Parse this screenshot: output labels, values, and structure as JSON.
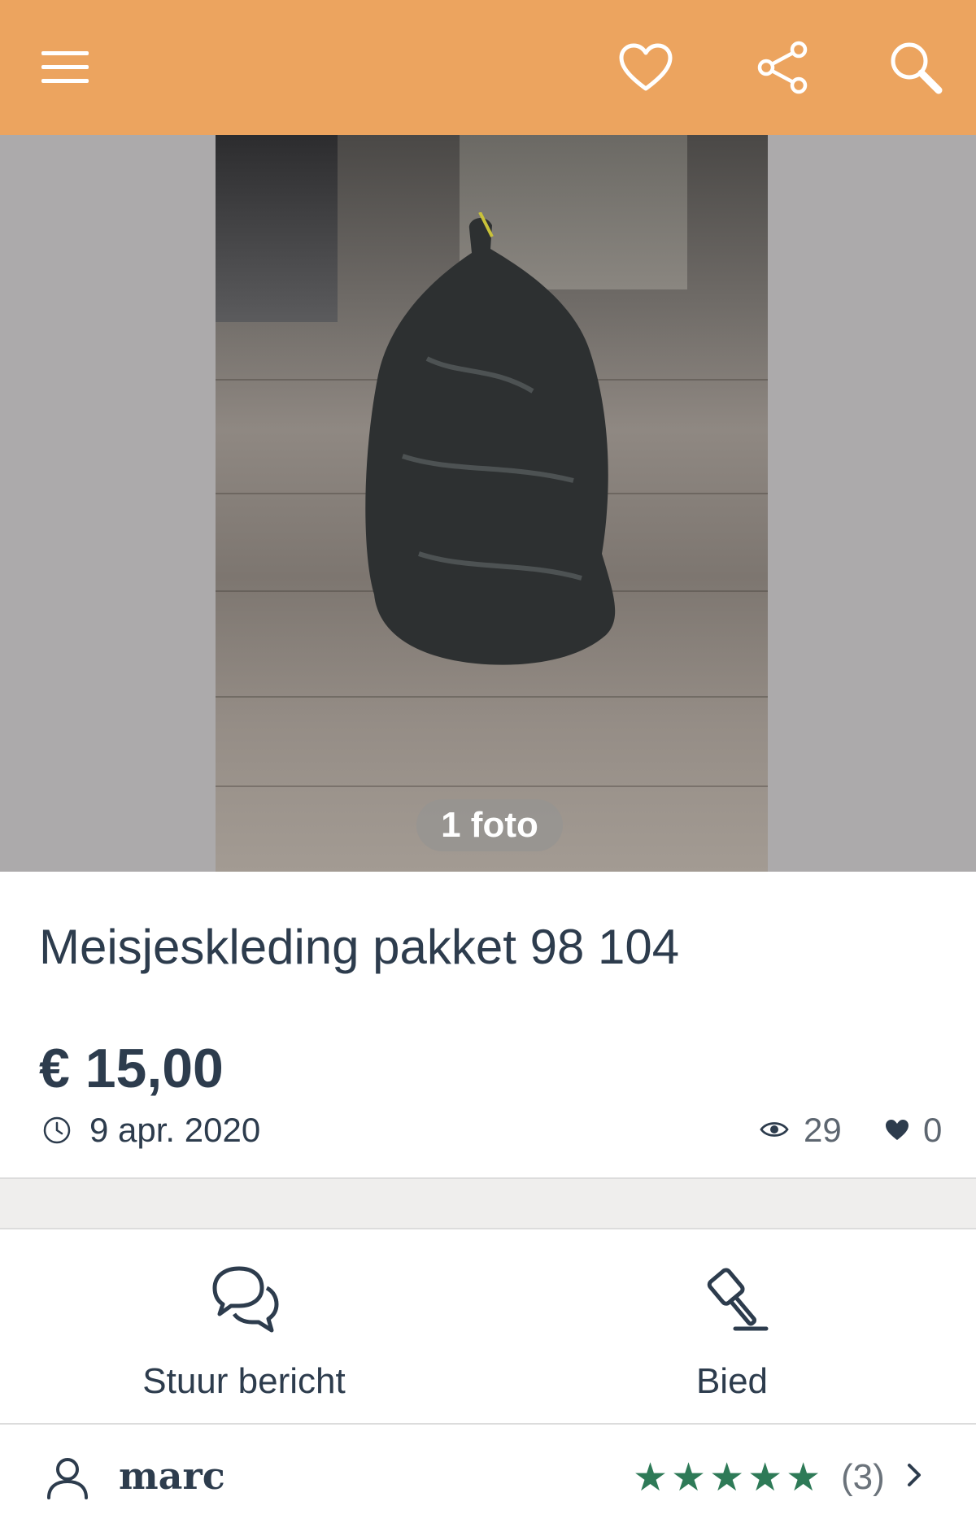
{
  "header": {
    "menu_icon": "hamburger-menu-icon",
    "favorite_icon": "heart-outline-icon",
    "share_icon": "share-icon",
    "search_icon": "search-icon",
    "background_color": "#eca45f"
  },
  "gallery": {
    "photo_count_label": "1 foto"
  },
  "listing": {
    "title": "Meisjeskleding pakket 98 104",
    "price": "€ 15,00",
    "date": "9 apr. 2020",
    "views": "29",
    "likes": "0"
  },
  "actions": {
    "message_label": "Stuur bericht",
    "bid_label": "Bied"
  },
  "seller": {
    "name": "marc",
    "rating_stars": 5,
    "review_count": "(3)",
    "star_color": "#2e7a57"
  }
}
